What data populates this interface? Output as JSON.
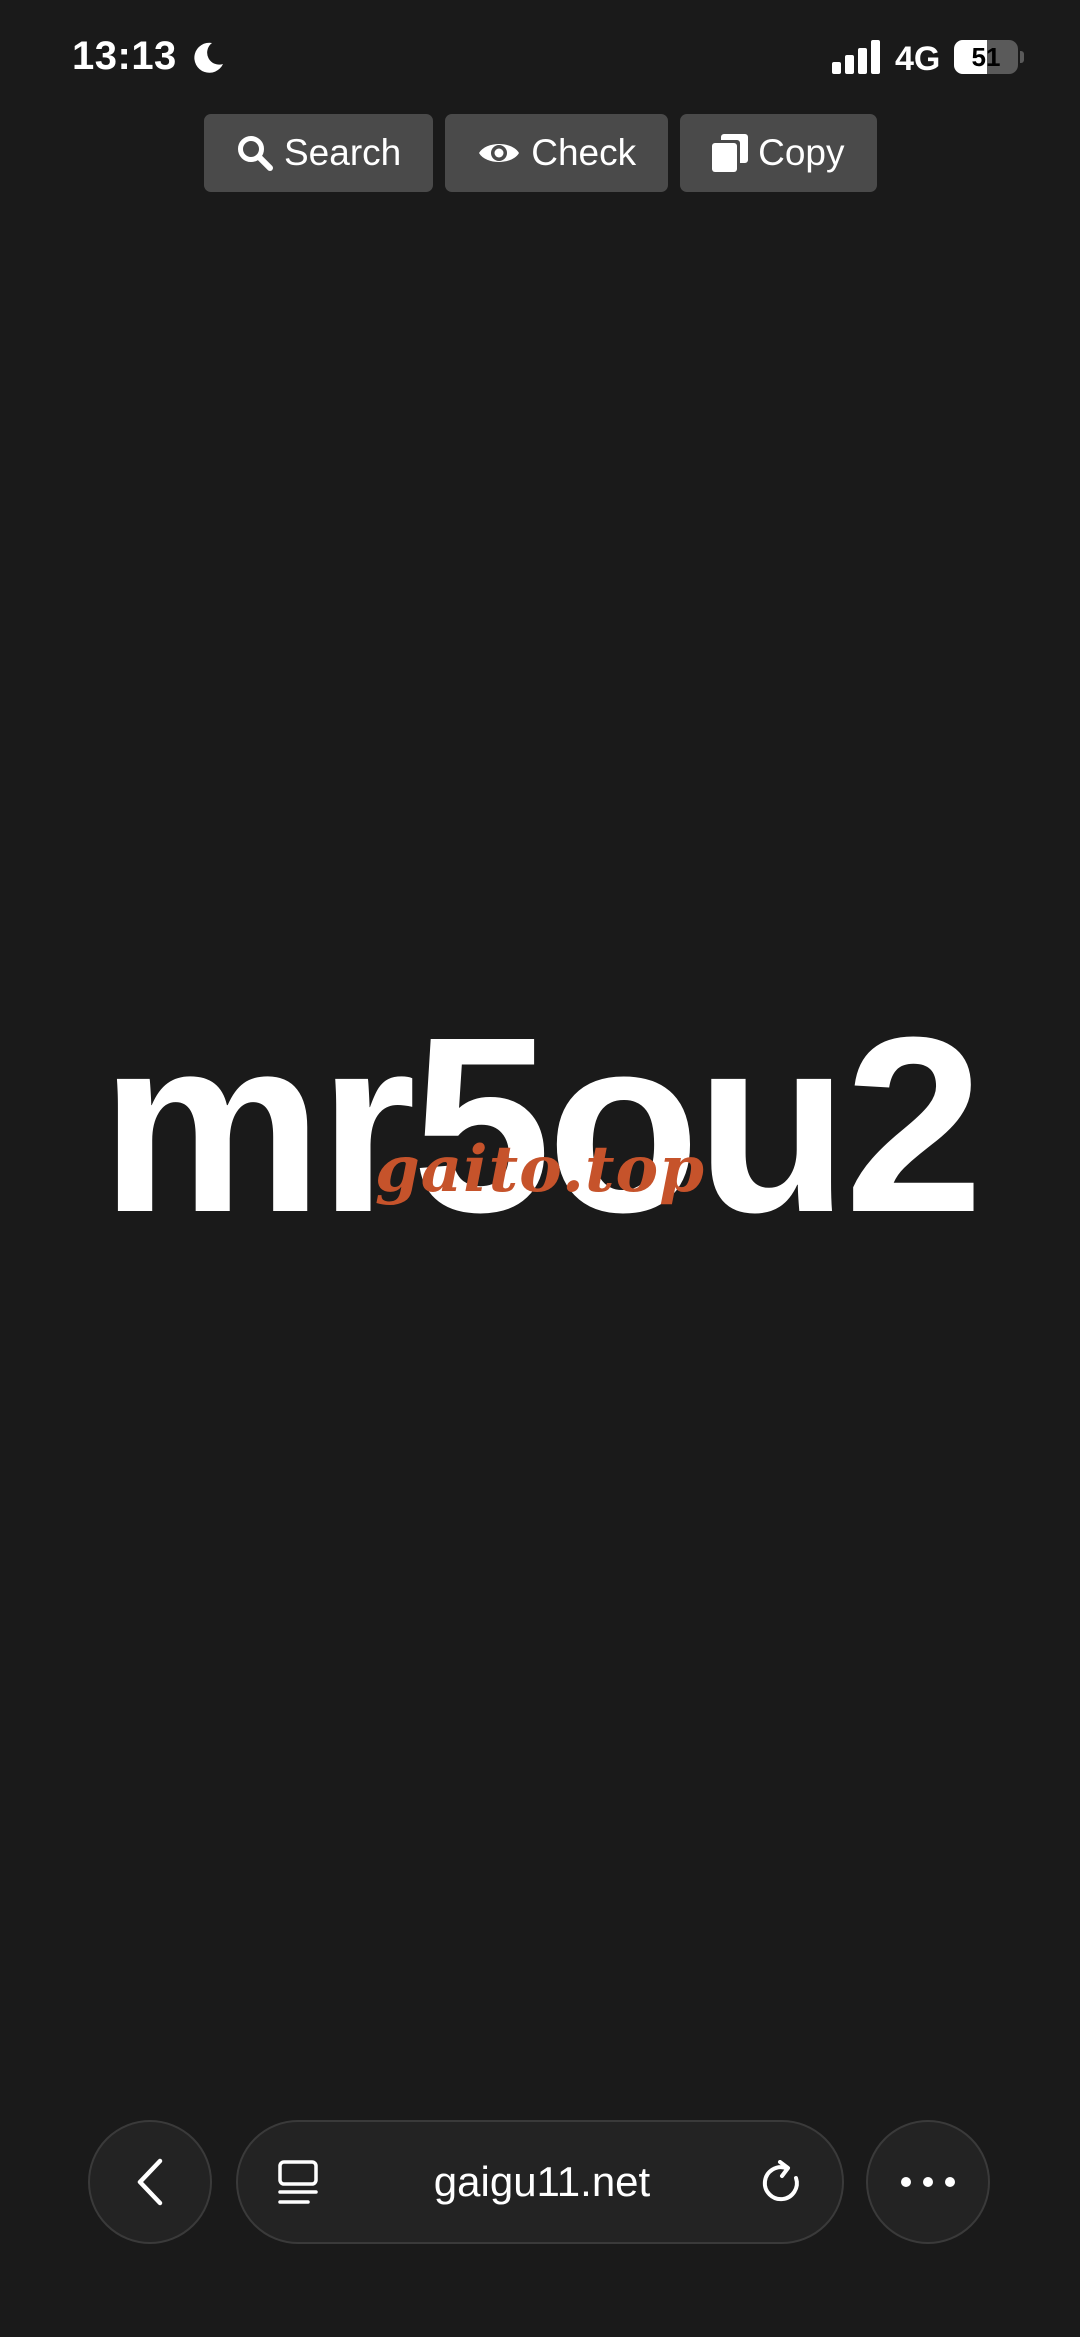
{
  "status_bar": {
    "time": "13:13",
    "network": "4G",
    "battery_level": "51",
    "battery_fraction": 0.51,
    "icons": [
      "moon-icon",
      "signal-icon",
      "battery-icon"
    ]
  },
  "toolbar": {
    "search_label": "Search",
    "check_label": "Check",
    "copy_label": "Copy"
  },
  "main": {
    "code": "mr5ou2",
    "watermark": "gaito.top"
  },
  "browser_bar": {
    "url": "gaigu11.net",
    "icons": [
      "back-icon",
      "tabs-icon",
      "reload-icon",
      "more-icon"
    ]
  },
  "colors": {
    "background": "#1a1a1a",
    "button": "#4a4a4a",
    "watermark": "#c6532b",
    "text": "#ffffff"
  }
}
